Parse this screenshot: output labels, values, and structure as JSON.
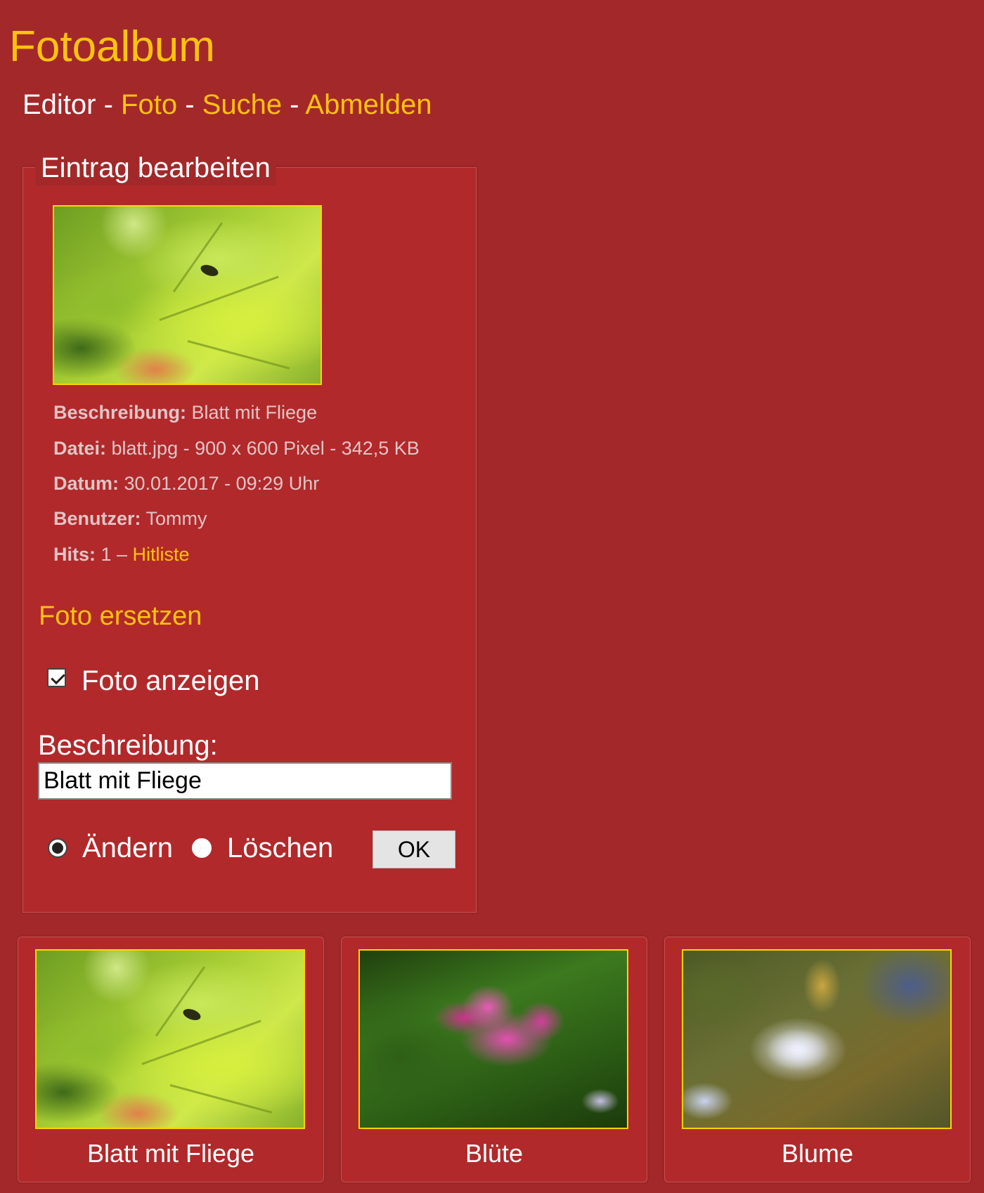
{
  "site": {
    "title": "Fotoalbum"
  },
  "nav": {
    "current": "Editor",
    "separator": " - ",
    "links": [
      "Foto",
      "Suche",
      "Abmelden"
    ]
  },
  "editor": {
    "legend": "Eintrag bearbeiten",
    "photo_icon": "leaf-with-fly-photo",
    "info": {
      "description_label": "Beschreibung:",
      "description_value": " Blatt mit Fliege",
      "file_label": "Datei:",
      "file_value": " blatt.jpg - 900 x 600 Pixel - 342,5 KB",
      "date_label": "Datum:",
      "date_value": " 30.01.2017 - 09:29 Uhr",
      "user_label": "Benutzer:",
      "user_value": " Tommy",
      "hits_label": "Hits:",
      "hits_value": " 1 – ",
      "hitlist_link": "Hitliste"
    },
    "replace_link": "Foto ersetzen",
    "show_photo": {
      "label": "Foto anzeigen",
      "checked": true
    },
    "description_field": {
      "label": "Beschreibung:",
      "value": "Blatt mit Fliege"
    },
    "action": {
      "options": [
        "Ändern",
        "Löschen"
      ],
      "selected": "Ändern"
    },
    "submit_label": "OK"
  },
  "gallery": [
    {
      "caption": "Blatt mit Fliege",
      "icon": "leaf-with-fly-photo"
    },
    {
      "caption": "Blüte",
      "icon": "pink-blossom-photo"
    },
    {
      "caption": "Blume",
      "icon": "white-flower-photo"
    }
  ],
  "colors": {
    "background": "#a3282a",
    "panel": "#b1292b",
    "accent": "#ffc20e",
    "photo_border": "#ffd500"
  }
}
